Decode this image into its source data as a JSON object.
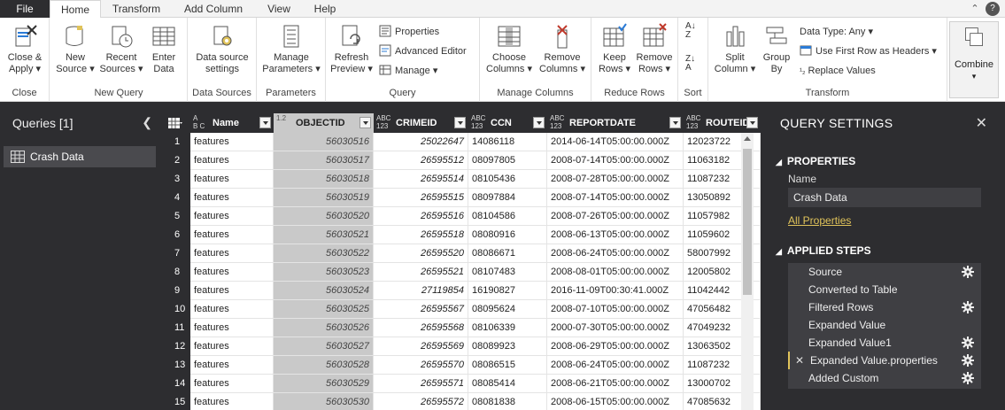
{
  "tabs": {
    "file": "File",
    "home": "Home",
    "transform": "Transform",
    "add_column": "Add Column",
    "view": "View",
    "help": "Help"
  },
  "window_icons": [
    "chevron-up-icon",
    "help-icon"
  ],
  "ribbon": {
    "close": {
      "close_apply_l1": "Close &",
      "close_apply_l2": "Apply",
      "label": "Close"
    },
    "new_query": {
      "new_source_l1": "New",
      "new_source_l2": "Source",
      "recent_sources_l1": "Recent",
      "recent_sources_l2": "Sources",
      "enter_data_l1": "Enter",
      "enter_data_l2": "Data",
      "label": "New Query"
    },
    "data_sources": {
      "settings_l1": "Data source",
      "settings_l2": "settings",
      "label": "Data Sources"
    },
    "parameters": {
      "manage_l1": "Manage",
      "manage_l2": "Parameters",
      "label": "Parameters"
    },
    "query": {
      "refresh_l1": "Refresh",
      "refresh_l2": "Preview",
      "properties": "Properties",
      "advanced_editor": "Advanced Editor",
      "manage": "Manage",
      "label": "Query"
    },
    "manage_columns": {
      "choose_l1": "Choose",
      "choose_l2": "Columns",
      "remove_l1": "Remove",
      "remove_l2": "Columns",
      "label": "Manage Columns"
    },
    "reduce_rows": {
      "keep_l1": "Keep",
      "keep_l2": "Rows",
      "remove_l1": "Remove",
      "remove_l2": "Rows",
      "label": "Reduce Rows"
    },
    "sort": {
      "label": "Sort"
    },
    "transform": {
      "split_l1": "Split",
      "split_l2": "Column",
      "group_l1": "Group",
      "group_l2": "By",
      "data_type": "Data Type: Any",
      "first_row": "Use First Row as Headers",
      "replace": "Replace Values",
      "label": "Transform"
    },
    "combine": {
      "label": "Combine"
    }
  },
  "queries_pane": {
    "title": "Queries [1]",
    "items": [
      "Crash Data"
    ]
  },
  "grid": {
    "columns": [
      {
        "type_top": "A",
        "type_bottom": "B C",
        "name": "Name"
      },
      {
        "type_top": "1.2",
        "type_bottom": "",
        "name": "OBJECTID"
      },
      {
        "type_top": "ABC",
        "type_bottom": "123",
        "name": "CRIMEID"
      },
      {
        "type_top": "ABC",
        "type_bottom": "123",
        "name": "CCN"
      },
      {
        "type_top": "ABC",
        "type_bottom": "123",
        "name": "REPORTDATE"
      },
      {
        "type_top": "ABC",
        "type_bottom": "123",
        "name": "ROUTEID"
      }
    ],
    "rows": [
      [
        "1",
        "features",
        "56030516",
        "25022647",
        "14086118",
        "2014-06-14T05:00:00.000Z",
        "12023722"
      ],
      [
        "2",
        "features",
        "56030517",
        "26595512",
        "08097805",
        "2008-07-14T05:00:00.000Z",
        "11063182"
      ],
      [
        "3",
        "features",
        "56030518",
        "26595514",
        "08105436",
        "2008-07-28T05:00:00.000Z",
        "11087232"
      ],
      [
        "4",
        "features",
        "56030519",
        "26595515",
        "08097884",
        "2008-07-14T05:00:00.000Z",
        "13050892"
      ],
      [
        "5",
        "features",
        "56030520",
        "26595516",
        "08104586",
        "2008-07-26T05:00:00.000Z",
        "11057982"
      ],
      [
        "6",
        "features",
        "56030521",
        "26595518",
        "08080916",
        "2008-06-13T05:00:00.000Z",
        "11059602"
      ],
      [
        "7",
        "features",
        "56030522",
        "26595520",
        "08086671",
        "2008-06-24T05:00:00.000Z",
        "58007992"
      ],
      [
        "8",
        "features",
        "56030523",
        "26595521",
        "08107483",
        "2008-08-01T05:00:00.000Z",
        "12005802"
      ],
      [
        "9",
        "features",
        "56030524",
        "27119854",
        "16190827",
        "2016-11-09T00:30:41.000Z",
        "11042442"
      ],
      [
        "10",
        "features",
        "56030525",
        "26595567",
        "08095624",
        "2008-07-10T05:00:00.000Z",
        "47056482"
      ],
      [
        "11",
        "features",
        "56030526",
        "26595568",
        "08106339",
        "2000-07-30T05:00:00.000Z",
        "47049232"
      ],
      [
        "12",
        "features",
        "56030527",
        "26595569",
        "08089923",
        "2008-06-29T05:00:00.000Z",
        "13063502"
      ],
      [
        "13",
        "features",
        "56030528",
        "26595570",
        "08086515",
        "2008-06-24T05:00:00.000Z",
        "11087232"
      ],
      [
        "14",
        "features",
        "56030529",
        "26595571",
        "08085414",
        "2008-06-21T05:00:00.000Z",
        "13000702"
      ],
      [
        "15",
        "features",
        "56030530",
        "26595572",
        "08081838",
        "2008-06-15T05:00:00.000Z",
        "47085632"
      ]
    ]
  },
  "query_settings": {
    "title": "QUERY SETTINGS",
    "properties_header": "PROPERTIES",
    "name_label": "Name",
    "name_value": "Crash Data",
    "all_properties": "All Properties",
    "applied_steps_header": "APPLIED STEPS",
    "steps": [
      {
        "label": "Source",
        "gear": true,
        "active": false
      },
      {
        "label": "Converted to Table",
        "gear": false,
        "active": false
      },
      {
        "label": "Filtered Rows",
        "gear": true,
        "active": false
      },
      {
        "label": "Expanded Value",
        "gear": false,
        "active": false
      },
      {
        "label": "Expanded Value1",
        "gear": true,
        "active": false
      },
      {
        "label": "Expanded Value.properties",
        "gear": true,
        "active": true
      },
      {
        "label": "Added Custom",
        "gear": true,
        "active": false
      }
    ]
  },
  "colors": {
    "dark_pane": "#2d2d30",
    "accent": "#e0c35a",
    "selected_column": "#c9c9c9"
  }
}
